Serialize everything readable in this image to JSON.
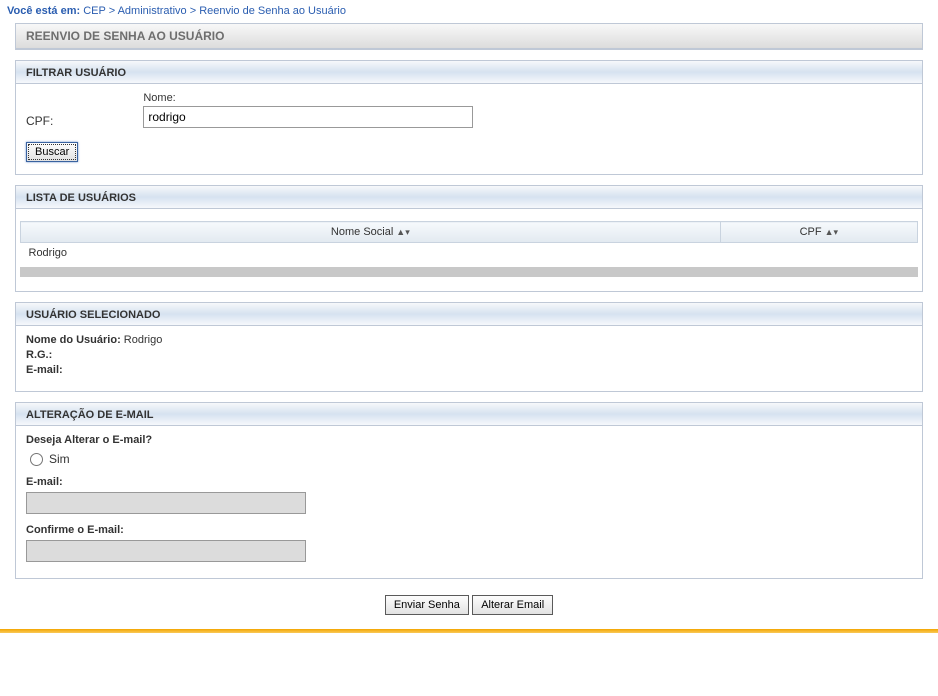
{
  "breadcrumb": {
    "prefix": "Você está em:",
    "path": "CEP > Administrativo > Reenvio de Senha ao Usuário"
  },
  "mainTitle": "REENVIO DE SENHA AO USUÁRIO",
  "filter": {
    "title": "FILTRAR USUÁRIO",
    "cpfLabel": "CPF:",
    "nomeLabel": "Nome:",
    "nomeValue": "rodrigo",
    "searchLabel": "Buscar"
  },
  "list": {
    "title": "LISTA DE USUÁRIOS",
    "columns": {
      "nome": "Nome Social",
      "cpf": "CPF"
    },
    "rows": [
      {
        "nome": "Rodrigo",
        "cpf": ""
      }
    ]
  },
  "selected": {
    "title": "USUÁRIO SELECIONADO",
    "nomeLabel": "Nome do Usuário:",
    "nomeValue": "Rodrigo",
    "rgLabel": "R.G.:",
    "rgValue": "",
    "emailLabel": "E-mail:",
    "emailValue": ""
  },
  "alterEmail": {
    "title": "ALTERAÇÃO DE E-MAIL",
    "question": "Deseja Alterar o E-mail?",
    "optionYes": "Sim",
    "emailLabel": "E-mail:",
    "confirmLabel": "Confirme o E-mail:"
  },
  "actions": {
    "send": "Enviar Senha",
    "alter": "Alterar Email"
  }
}
